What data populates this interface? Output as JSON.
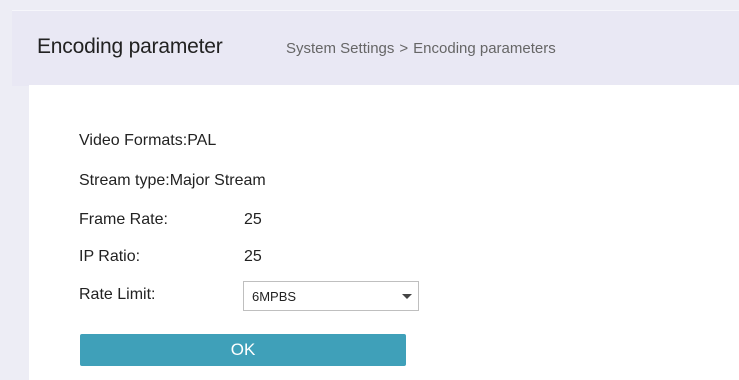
{
  "header": {
    "title": "Encoding parameter",
    "breadcrumb": {
      "parent": "System Settings",
      "separator": ">",
      "current": "Encoding parameters"
    }
  },
  "form": {
    "video_formats": "Video Formats:PAL",
    "stream_type": "Stream type:Major Stream",
    "frame_rate": {
      "label": "Frame Rate:",
      "value": "25"
    },
    "ip_ratio": {
      "label": "IP Ratio:",
      "value": "25"
    },
    "rate_limit": {
      "label": "Rate Limit:",
      "selected": "6MPBS"
    },
    "ok_label": "OK"
  },
  "colors": {
    "header_bg": "#e9e8f4",
    "ok_button": "#3fa0b9"
  }
}
